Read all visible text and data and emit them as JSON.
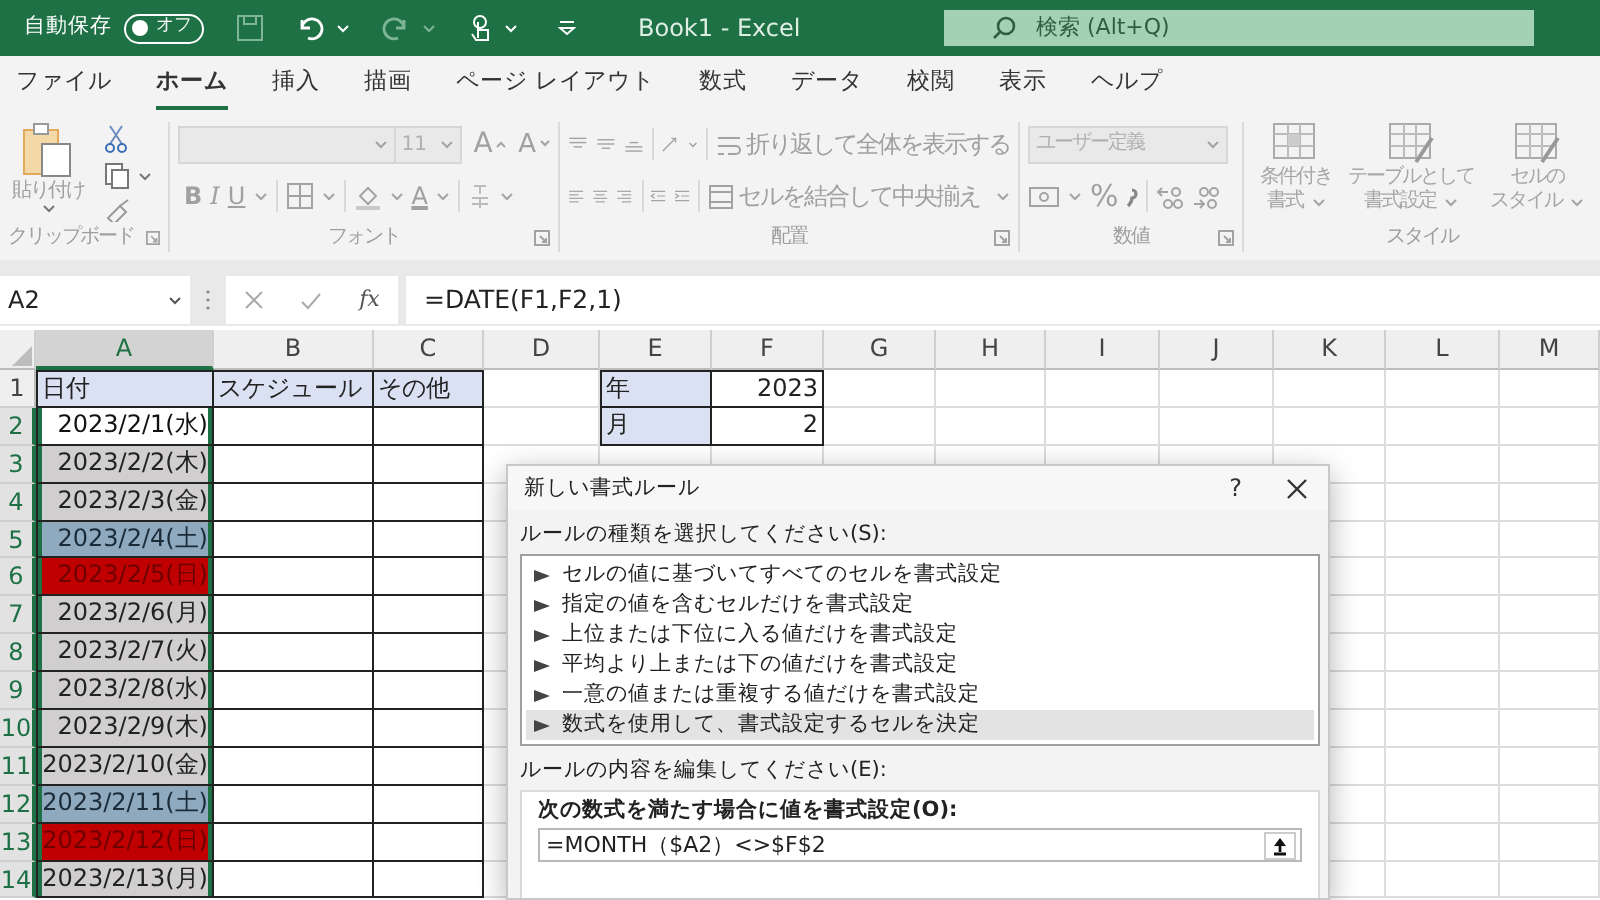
{
  "title_bar": {
    "autosave_label": "自動保存",
    "autosave_toggle": {
      "label": "オフ",
      "on": false
    },
    "document_title": "Book1  -  Excel",
    "search_placeholder": "検索 (Alt+Q)"
  },
  "tabs": [
    {
      "label": "ファイル",
      "selected": false
    },
    {
      "label": "ホーム",
      "selected": true
    },
    {
      "label": "挿入",
      "selected": false
    },
    {
      "label": "描画",
      "selected": false
    },
    {
      "label": "ページ レイアウト",
      "selected": false
    },
    {
      "label": "数式",
      "selected": false
    },
    {
      "label": "データ",
      "selected": false
    },
    {
      "label": "校閲",
      "selected": false
    },
    {
      "label": "表示",
      "selected": false
    },
    {
      "label": "ヘルプ",
      "selected": false
    }
  ],
  "ribbon": {
    "clipboard": {
      "paste_label": "貼り付け",
      "group_label": "クリップボード"
    },
    "font": {
      "font_size": "11",
      "grow_label": "A",
      "shrink_label": "A",
      "bold_label": "B",
      "italic_label": "I",
      "underline_label": "U",
      "font_color_label": "A",
      "group_label": "フォント"
    },
    "alignment": {
      "wrap_text_label": "折り返して全体を表示する",
      "merge_label": "セルを結合して中央揃え",
      "group_label": "配置"
    },
    "number": {
      "format_value": "ユーザー定義",
      "percent_label": "%",
      "group_label": "数値"
    },
    "styles": {
      "buttons": [
        {
          "lines": [
            "条件付き",
            "書式"
          ]
        },
        {
          "lines": [
            "テーブルとして",
            "書式設定"
          ]
        },
        {
          "lines": [
            "セルの",
            "スタイル"
          ]
        }
      ],
      "group_label": "スタイル"
    }
  },
  "formula_bar": {
    "name_box": "A2",
    "fx_label": "fx",
    "formula": "=DATE(F1,F2,1)"
  },
  "sheet": {
    "columns": [
      {
        "label": "A",
        "selected": true
      },
      {
        "label": "B",
        "selected": false
      },
      {
        "label": "C",
        "selected": false
      },
      {
        "label": "D",
        "selected": false
      },
      {
        "label": "E",
        "selected": false
      },
      {
        "label": "F",
        "selected": false
      },
      {
        "label": "G",
        "selected": false
      },
      {
        "label": "H",
        "selected": false
      },
      {
        "label": "I",
        "selected": false
      },
      {
        "label": "J",
        "selected": false
      },
      {
        "label": "K",
        "selected": false
      },
      {
        "label": "L",
        "selected": false
      },
      {
        "label": "M",
        "selected": false
      }
    ],
    "row_numbers": [
      {
        "label": "1",
        "selected": false
      },
      {
        "label": "2",
        "selected": true
      },
      {
        "label": "3",
        "selected": true
      },
      {
        "label": "4",
        "selected": true
      },
      {
        "label": "5",
        "selected": true
      },
      {
        "label": "6",
        "selected": true
      },
      {
        "label": "7",
        "selected": true
      },
      {
        "label": "8",
        "selected": true
      },
      {
        "label": "9",
        "selected": true
      },
      {
        "label": "10",
        "selected": true
      },
      {
        "label": "11",
        "selected": true
      },
      {
        "label": "12",
        "selected": true
      },
      {
        "label": "13",
        "selected": true
      },
      {
        "label": "14",
        "selected": true
      }
    ],
    "schedule_table": {
      "headers": [
        "日付",
        "スケジュール",
        "その他"
      ],
      "rows": [
        {
          "date": "2023/2/1(水)",
          "kind": "current"
        },
        {
          "date": "2023/2/2(木)",
          "kind": "weekday"
        },
        {
          "date": "2023/2/3(金)",
          "kind": "weekday"
        },
        {
          "date": "2023/2/4(土)",
          "kind": "saturday"
        },
        {
          "date": "2023/2/5(日)",
          "kind": "sunday"
        },
        {
          "date": "2023/2/6(月)",
          "kind": "weekday"
        },
        {
          "date": "2023/2/7(火)",
          "kind": "weekday"
        },
        {
          "date": "2023/2/8(水)",
          "kind": "weekday"
        },
        {
          "date": "2023/2/9(木)",
          "kind": "weekday"
        },
        {
          "date": "2023/2/10(金)",
          "kind": "weekday"
        },
        {
          "date": "2023/2/11(土)",
          "kind": "saturday"
        },
        {
          "date": "2023/2/12(日)",
          "kind": "sunday"
        },
        {
          "date": "2023/2/13(月)",
          "kind": "weekday"
        }
      ]
    },
    "side_table": [
      {
        "label": "年",
        "value": "2023"
      },
      {
        "label": "月",
        "value": "2"
      }
    ]
  },
  "dialog": {
    "title": "新しい書式ルール",
    "help_label": "?",
    "rule_type_label": "ルールの種類を選択してください(S):",
    "rule_types": [
      {
        "label": "セルの値に基づいてすべてのセルを書式設定",
        "selected": false
      },
      {
        "label": "指定の値を含むセルだけを書式設定",
        "selected": false
      },
      {
        "label": "上位または下位に入る値だけを書式設定",
        "selected": false
      },
      {
        "label": "平均より上または下の値だけを書式設定",
        "selected": false
      },
      {
        "label": "一意の値または重複する値だけを書式設定",
        "selected": false
      },
      {
        "label": "数式を使用して、書式設定するセルを決定",
        "selected": true
      }
    ],
    "edit_label": "ルールの内容を編集してください(E):",
    "formula_label": "次の数式を満たす場合に値を書式設定(O):",
    "formula_value": "=MONTH（$A2）<>$F$2"
  }
}
